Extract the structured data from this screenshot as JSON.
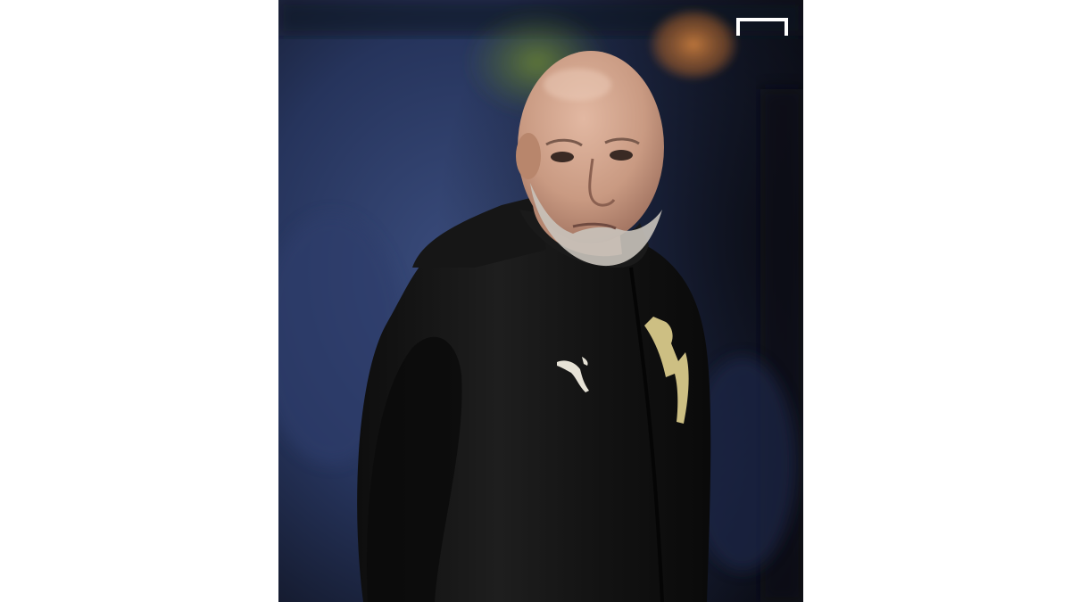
{
  "image": {
    "alt": "",
    "background_color": "#ffffff",
    "photo_palette": {
      "stadium_blue": "#26345c",
      "stadium_dark": "#0b0d16",
      "bokeh_green": "#4f6b2c",
      "bokeh_orange": "#b66a34",
      "skin": "#c99a82",
      "beard": "#c9c3bb",
      "jacket": "#141414",
      "crest_gold": "#d8c98a"
    },
    "icons": [
      "goal-frame-logo-icon",
      "puma-logo-icon",
      "club-crest-icon"
    ]
  }
}
